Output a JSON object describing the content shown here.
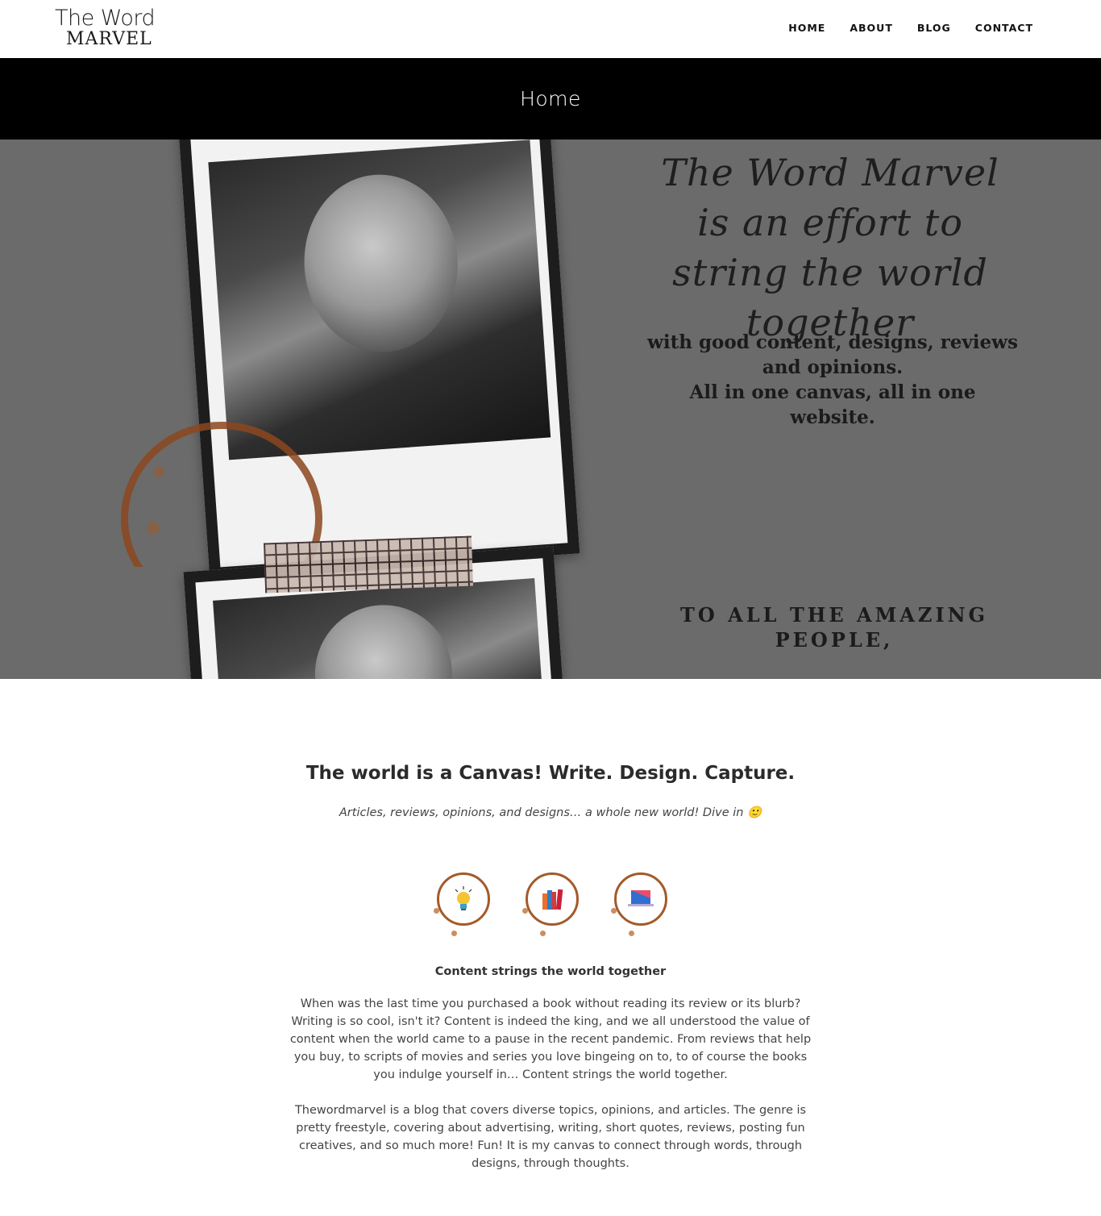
{
  "header": {
    "logo_line1": "The Word",
    "logo_line2": "MARVEL",
    "nav": [
      "HOME",
      "ABOUT",
      "BLOG",
      "CONTACT"
    ]
  },
  "title_band": {
    "title": "Home"
  },
  "hero": {
    "script_text": "The Word Marvel is an effort to string the world together",
    "subtext_line1": "with good content, designs, reviews and opinions.",
    "subtext_line2": "All in one canvas, all in one website.",
    "people_text": "TO ALL THE AMAZING PEOPLE,"
  },
  "intro": {
    "heading": "The world is a Canvas! Write. Design. Capture.",
    "subheading": "Articles, reviews, opinions, and designs… a whole new world! Dive in 🙂"
  },
  "icons": [
    "lightbulb-icon",
    "books-icon",
    "laptop-icon"
  ],
  "feature": {
    "title": "Content strings the world together",
    "paragraph1": "When was the last time you purchased a book without reading its review or its blurb? Writing is so cool, isn't it? Content is indeed the king, and we all understood the value of content when the world came to a pause in the recent pandemic. From reviews that help you buy, to scripts of movies and series you love bingeing on to, to of course the books you indulge yourself in… Content strings the world together.",
    "paragraph2": "Thewordmarvel is a blog that covers diverse topics, opinions, and articles. The genre is pretty freestyle, covering about advertising, writing, short quotes, reviews, posting fun creatives, and so much more! Fun! It is my canvas to connect through words, through designs, through thoughts."
  },
  "colors": {
    "title_band": "#000000",
    "hero_bg": "#6b6b6b",
    "coffee_ring": "#a35a2a"
  }
}
